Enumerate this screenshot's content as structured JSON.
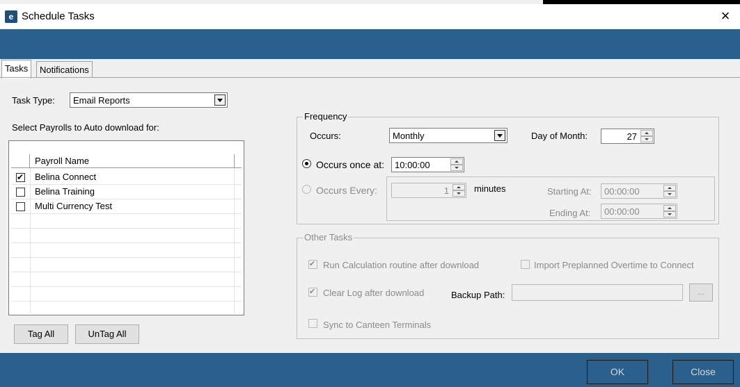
{
  "window": {
    "title": "Schedule Tasks"
  },
  "tabs": [
    {
      "label": "Tasks",
      "active": true
    },
    {
      "label": "Notifications",
      "active": false
    }
  ],
  "task_type": {
    "label": "Task Type:",
    "value": "Email Reports"
  },
  "payroll_section": {
    "label": "Select Payrolls to Auto download for:"
  },
  "payroll_grid": {
    "column": "Payroll Name",
    "rows": [
      {
        "name": "Belina Connect",
        "checked": true
      },
      {
        "name": "Belina Training",
        "checked": false
      },
      {
        "name": "Multi Currency Test",
        "checked": false
      }
    ]
  },
  "buttons": {
    "tag_all": "Tag All",
    "untag_all": "UnTag All",
    "ok": "OK",
    "close": "Close",
    "browse": "..."
  },
  "frequency": {
    "legend": "Frequency",
    "occurs_label": "Occurs:",
    "occurs_value": "Monthly",
    "day_of_month_label": "Day of Month:",
    "day_of_month_value": "27",
    "once_label": "Occurs once at:",
    "once_value": "10:00:00",
    "every_label": "Occurs Every:",
    "every_value": "1",
    "every_unit": "minutes",
    "starting_label": "Starting At:",
    "starting_value": "00:00:00",
    "ending_label": "Ending At:",
    "ending_value": "00:00:00"
  },
  "other_tasks": {
    "legend": "Other Tasks",
    "run_calc": "Run Calculation routine after download",
    "import_overtime": "Import Preplanned Overtime to Connect",
    "clear_log": "Clear Log after download",
    "backup_path_label": "Backup Path:",
    "backup_path_value": "",
    "sync_canteen": "Sync to Canteen Terminals"
  }
}
